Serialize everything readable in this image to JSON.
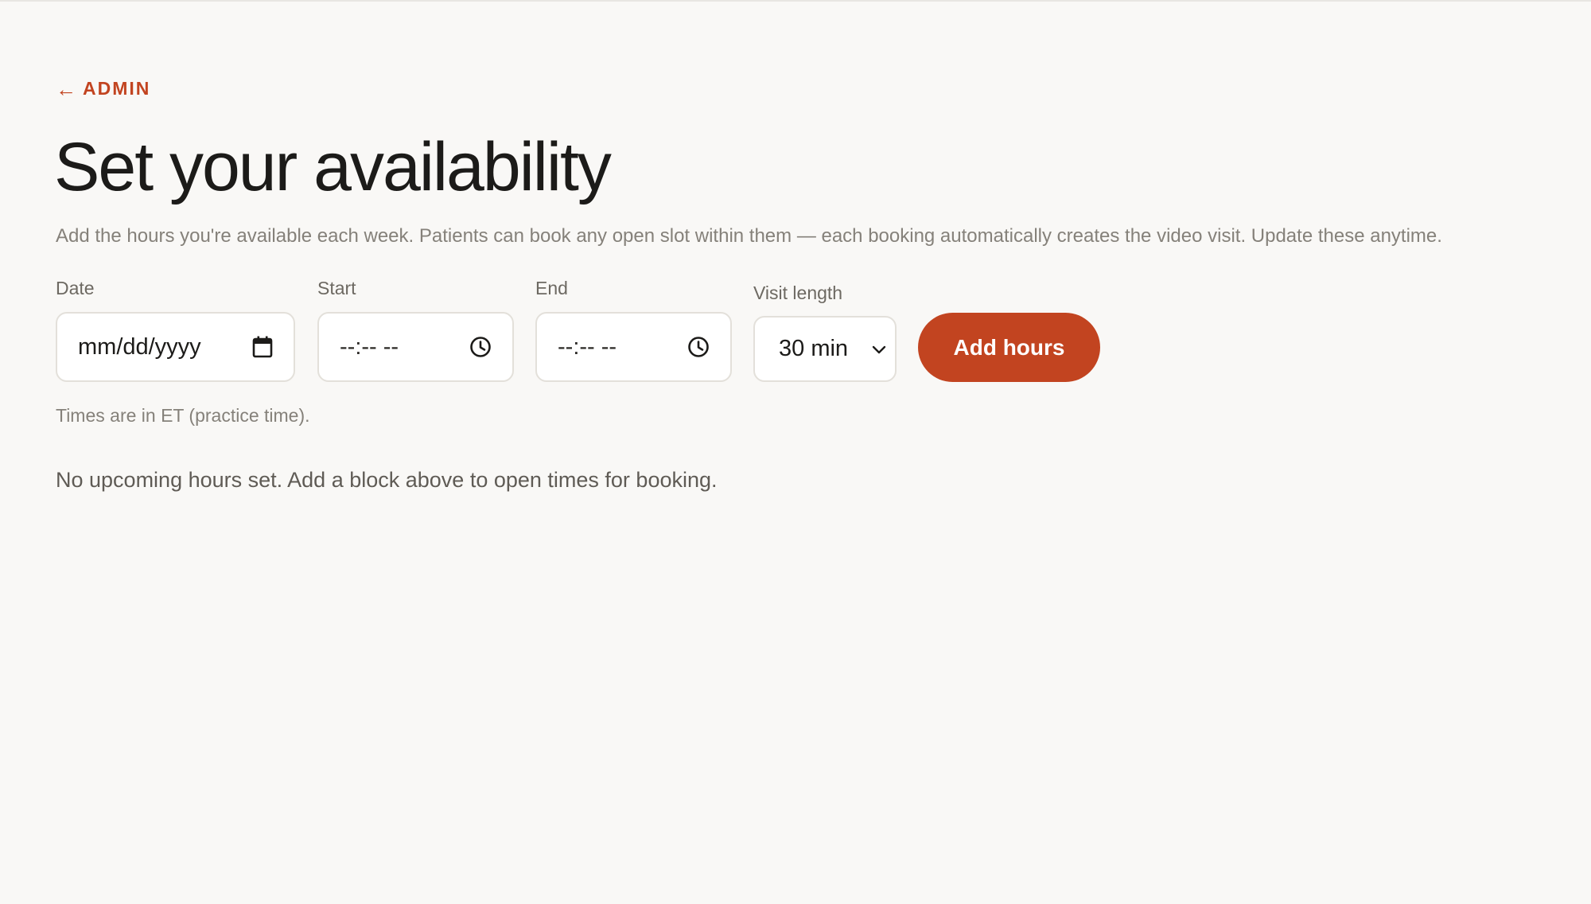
{
  "nav": {
    "back_arrow": "←",
    "back_label": "ADMIN"
  },
  "header": {
    "title": "Set your availability",
    "description": "Add the hours you're available each week. Patients can book any open slot within them — each booking automatically creates the video visit. Update these anytime."
  },
  "form": {
    "date": {
      "label": "Date",
      "value": "mm/dd/yyyy",
      "icon": "calendar-icon"
    },
    "start": {
      "label": "Start",
      "value": "--:-- --",
      "icon": "clock-icon"
    },
    "end": {
      "label": "End",
      "value": "--:-- --",
      "icon": "clock-icon"
    },
    "visit_length": {
      "label": "Visit length",
      "selected": "30 min",
      "icon": "chevron-down-icon"
    },
    "submit_label": "Add hours",
    "hint": "Times are in ET (practice time)."
  },
  "empty_state": "No upcoming hours set. Add a block above to open times for booking.",
  "colors": {
    "accent": "#c24420",
    "background": "#f9f8f6",
    "muted_text": "#85817a"
  }
}
